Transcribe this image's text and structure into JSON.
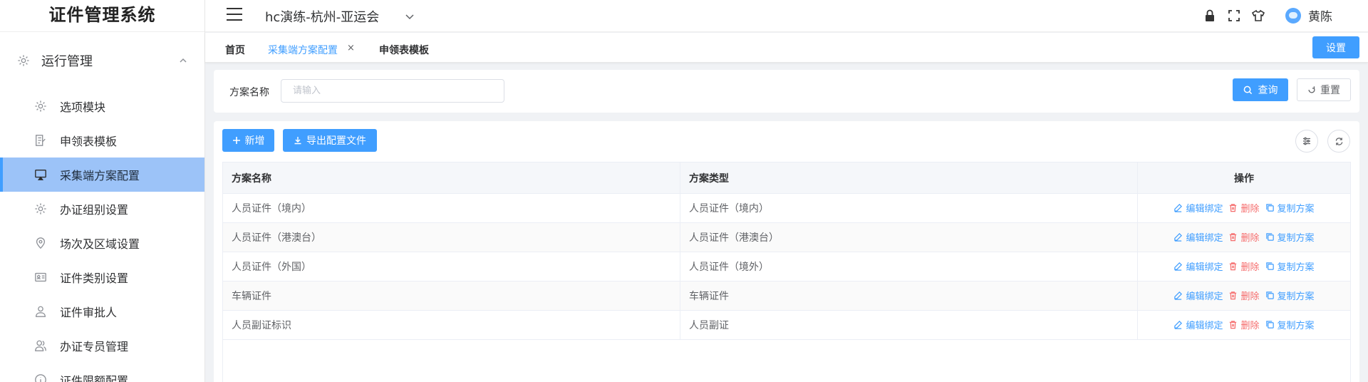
{
  "app": {
    "title": "证件管理系统"
  },
  "header": {
    "project": "hc演练-杭州-亚运会",
    "username": "黄陈"
  },
  "sidebar": {
    "group": {
      "label": "运行管理"
    },
    "items": [
      {
        "label": "选项模块",
        "icon": "gear-icon"
      },
      {
        "label": "申领表模板",
        "icon": "form-edit-icon"
      },
      {
        "label": "采集端方案配置",
        "icon": "monitor-icon",
        "active": true
      },
      {
        "label": "办证组别设置",
        "icon": "gear-icon"
      },
      {
        "label": "场次及区域设置",
        "icon": "location-pin-icon"
      },
      {
        "label": "证件类别设置",
        "icon": "id-card-icon"
      },
      {
        "label": "证件审批人",
        "icon": "user-icon"
      },
      {
        "label": "办证专员管理",
        "icon": "user-group-icon"
      },
      {
        "label": "证件限额配置",
        "icon": "info-icon"
      }
    ]
  },
  "tabs": {
    "items": [
      {
        "label": "首页"
      },
      {
        "label": "采集端方案配置",
        "active": true
      },
      {
        "label": "申领表模板"
      }
    ],
    "close_glyph": "×",
    "settings_label": "设置"
  },
  "search": {
    "label": "方案名称",
    "placeholder": "请输入",
    "query_label": "查询",
    "reset_label": "重置"
  },
  "toolbar": {
    "add_label": "新增",
    "export_label": "导出配置文件"
  },
  "table": {
    "headers": [
      "方案名称",
      "方案类型",
      "操作"
    ],
    "rows": [
      {
        "name": "人员证件（境内）",
        "type": "人员证件（境内）"
      },
      {
        "name": "人员证件（港澳台）",
        "type": "人员证件（港澳台）"
      },
      {
        "name": "人员证件（外国）",
        "type": "人员证件（境外）"
      },
      {
        "name": "车辆证件",
        "type": "车辆证件"
      },
      {
        "name": "人员副证标识",
        "type": "人员副证"
      }
    ],
    "actions": {
      "edit": "编辑绑定",
      "delete": "删除",
      "copy": "复制方案"
    }
  },
  "colors": {
    "primary": "#409eff",
    "danger": "#f56c6c",
    "active_menu_bg": "#9cc3f8"
  }
}
